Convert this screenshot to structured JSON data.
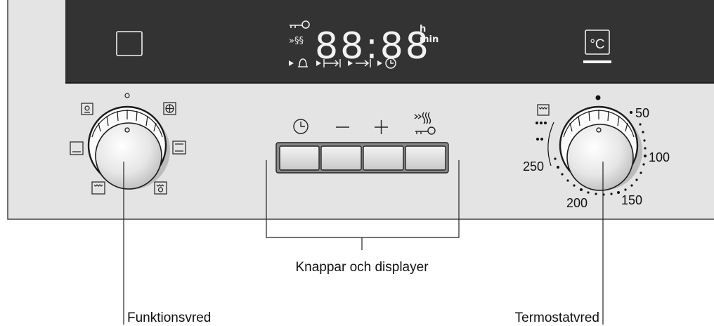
{
  "display": {
    "time": "88:88",
    "unit_h": "h",
    "unit_min": "min",
    "temp_unit": "°C"
  },
  "buttons": {
    "timer_symbol": "clock",
    "minus_symbol": "−",
    "plus_symbol": "+",
    "childlock_symbol": "fast-heat / key"
  },
  "thermostat": {
    "scale_labels": [
      "50",
      "100",
      "150",
      "200",
      "250"
    ]
  },
  "callouts": {
    "buttons_label": "Knappar och displayer",
    "function_label": "Funktionsvred",
    "thermostat_label": "Termostatvred"
  },
  "colors": {
    "panel": "#e4e4e4",
    "display": "#333333",
    "lcd_segment": "#f2f2f2"
  }
}
